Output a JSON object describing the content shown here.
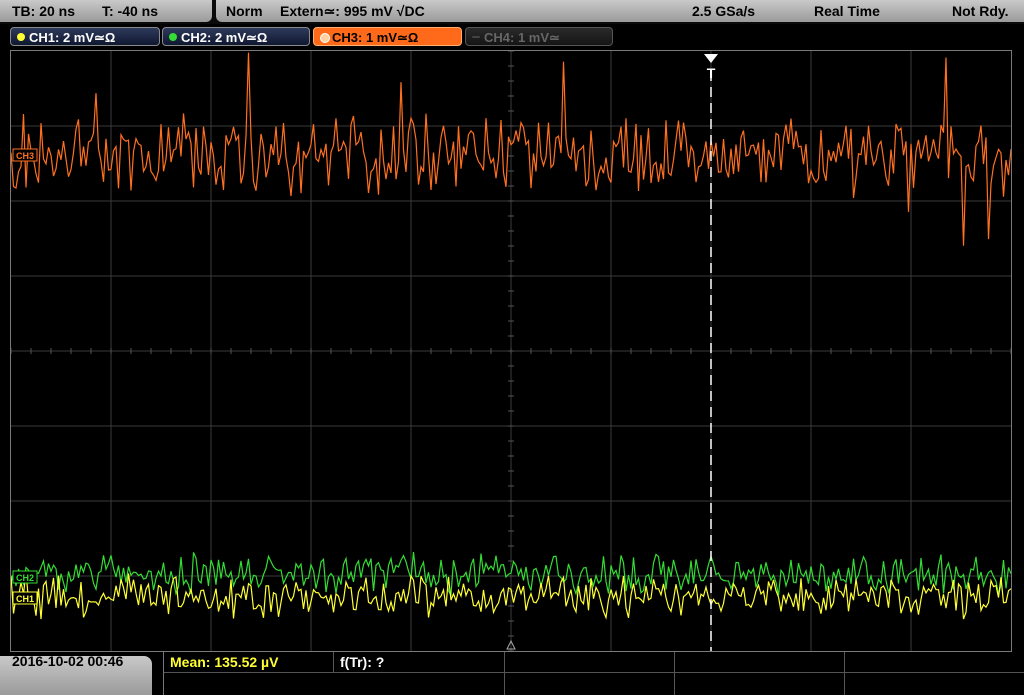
{
  "timebase": {
    "tb": "TB: 20 ns",
    "t": "T: -40 ns"
  },
  "status": {
    "mode": "Norm",
    "trigger": "Extern≃: 995 mV √DC",
    "sample_rate": "2.5 GSa/s",
    "acq": "Real Time",
    "state": "Not Rdy."
  },
  "channels": [
    {
      "label": "CH1: 2 mV≃Ω",
      "color": "#ffff33"
    },
    {
      "label": "CH2: 2 mV≃Ω",
      "color": "#33dd33"
    },
    {
      "label": "CH3: 1 mV≃Ω",
      "color": "#ff7020"
    },
    {
      "label": "CH4: 1 mV≃",
      "color": "#555555"
    }
  ],
  "markers": {
    "trigger": "T",
    "ch3": "CH3",
    "ch2": "CH2",
    "ch1": "CH1"
  },
  "footer": {
    "datetime": "2016-10-02 00:46",
    "mean": "Mean: 135.52 µV",
    "ftr": "f(Tr): ?"
  }
}
